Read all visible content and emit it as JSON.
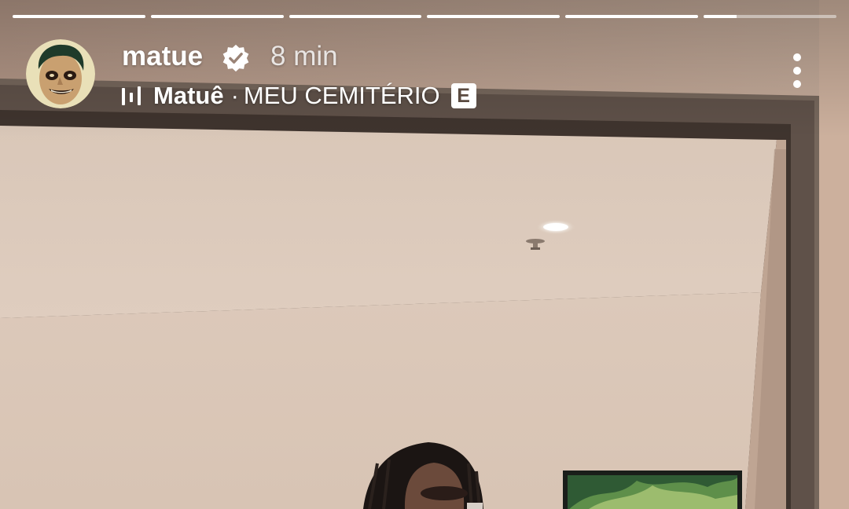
{
  "story": {
    "progress_segments": [
      1,
      1,
      1,
      1,
      1,
      0.25
    ]
  },
  "header": {
    "username": "matue",
    "verified_icon": "verified-badge-icon",
    "time_ago": "8 min",
    "more_icon": "more-vertical-icon"
  },
  "music": {
    "icon": "music-bars-icon",
    "artist": "Matuê",
    "separator": "·",
    "song": "MEU CEMITÉRIO",
    "explicit_label": "E"
  }
}
